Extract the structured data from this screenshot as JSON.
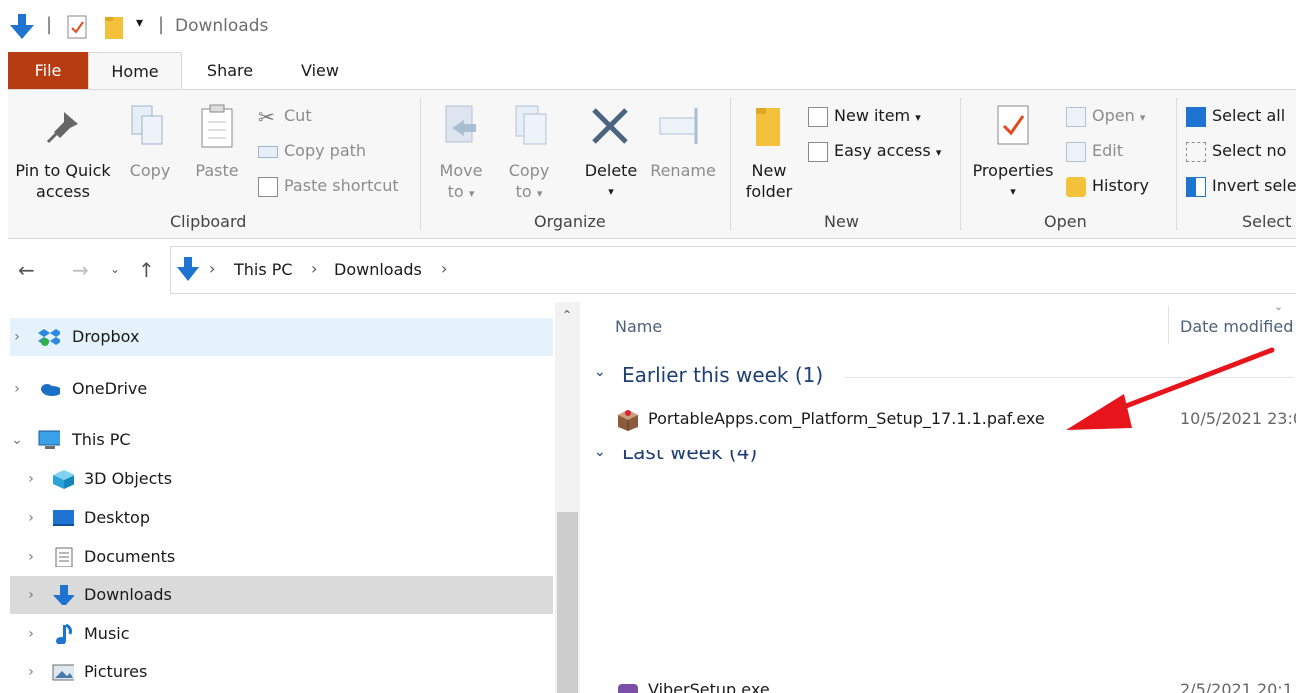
{
  "titlebar": {
    "title": "Downloads",
    "qat_separator": "|",
    "qat_dropdown": "▾"
  },
  "tabs": [
    {
      "label": "File"
    },
    {
      "label": "Home"
    },
    {
      "label": "Share"
    },
    {
      "label": "View"
    }
  ],
  "ribbon": {
    "clipboard": {
      "pin_line1": "Pin to Quick",
      "pin_line2": "access",
      "copy": "Copy",
      "paste": "Paste",
      "cut": "Cut",
      "copy_path": "Copy path",
      "paste_shortcut": "Paste shortcut",
      "group_label": "Clipboard"
    },
    "organize": {
      "move_to_line1": "Move",
      "move_to_line2": "to",
      "copy_to_line1": "Copy",
      "copy_to_line2": "to",
      "delete": "Delete",
      "rename": "Rename",
      "group_label": "Organize"
    },
    "new": {
      "new_folder_line1": "New",
      "new_folder_line2": "folder",
      "new_item": "New item",
      "easy_access": "Easy access",
      "group_label": "New"
    },
    "open": {
      "properties": "Properties",
      "open": "Open",
      "edit": "Edit",
      "history": "History",
      "group_label": "Open"
    },
    "select": {
      "select_all": "Select all",
      "select_none": "Select no",
      "invert_selection": "Invert sele",
      "group_label": "Select"
    }
  },
  "address": {
    "crumbs": [
      "This PC",
      "Downloads"
    ],
    "separator": "›"
  },
  "nav": {
    "items": [
      {
        "label": "Dropbox",
        "icon": "dropbox-icon"
      },
      {
        "label": "OneDrive",
        "icon": "onedrive-icon"
      },
      {
        "label": "This PC",
        "icon": "this-pc-icon"
      },
      {
        "label": "3D Objects",
        "icon": "3d-objects-icon"
      },
      {
        "label": "Desktop",
        "icon": "desktop-icon"
      },
      {
        "label": "Documents",
        "icon": "documents-icon"
      },
      {
        "label": "Downloads",
        "icon": "downloads-icon"
      },
      {
        "label": "Music",
        "icon": "music-icon"
      },
      {
        "label": "Pictures",
        "icon": "pictures-icon"
      }
    ]
  },
  "content": {
    "columns": {
      "name": "Name",
      "date_modified": "Date modified"
    },
    "groups": [
      {
        "label": "Earlier this week (1)",
        "files": [
          {
            "name": "PortableApps.com_Platform_Setup_17.1.1.paf.exe",
            "date": "10/5/2021 23:0"
          }
        ]
      },
      {
        "label": "Last week (4)",
        "files": []
      }
    ],
    "partial_file": {
      "name": "ViberSetup.exe",
      "date": "2/5/2021 20:1"
    }
  },
  "annotation": {
    "arrow_color": "#e8141b"
  },
  "colors": {
    "file_tab": "#b83c11",
    "selected_nav": "#dadada",
    "hover_nav": "#e5f1fb",
    "accent_blue": "#1f73d1"
  }
}
